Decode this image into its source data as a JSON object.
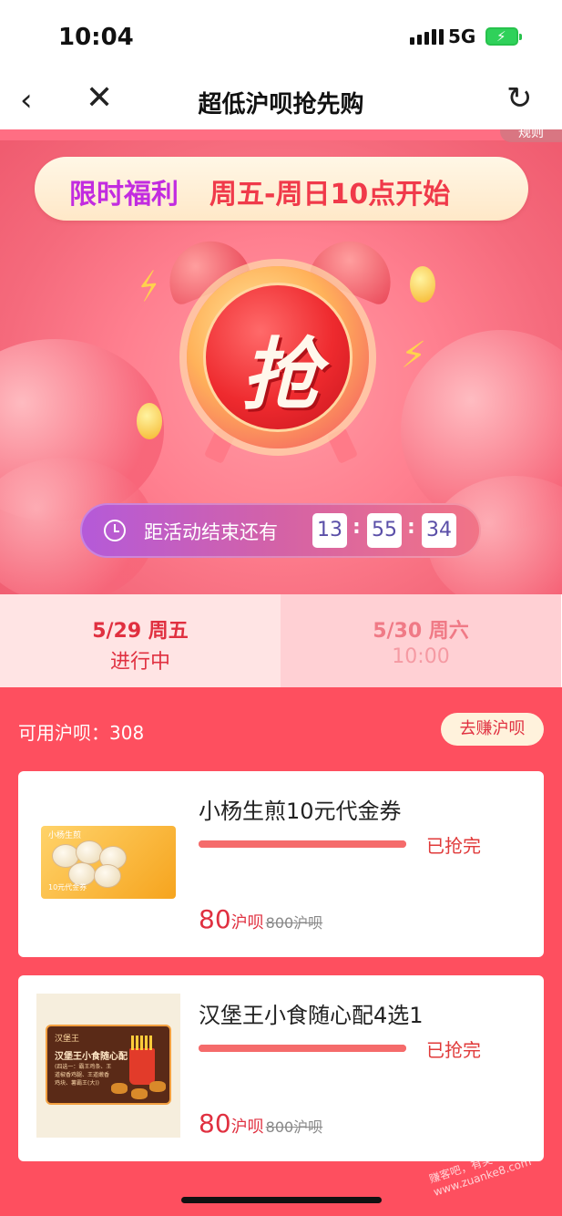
{
  "status_bar": {
    "time": "10:04",
    "network": "5G",
    "battery_color": "#2fd15a"
  },
  "nav": {
    "back_icon": "chevron-left-icon",
    "close_icon": "close-icon",
    "title": "超低沪呗抢先购",
    "refresh_icon": "refresh-icon"
  },
  "hero": {
    "rule_tab": "规则",
    "banner_left": "限时福利",
    "banner_right": "周五-周日10点开始",
    "clock_char": "抢",
    "countdown_label": "距活动结束还有",
    "countdown_hours": "13",
    "countdown_minutes": "55",
    "countdown_seconds": "34",
    "countdown_sep": ":"
  },
  "days": [
    {
      "date": "5/29 周五",
      "status": "进行中",
      "active": true
    },
    {
      "date": "5/30 周六",
      "status": "10:00",
      "active": false
    }
  ],
  "points": {
    "label": "可用沪呗：308",
    "earn_button": "去赚沪呗"
  },
  "products": [
    {
      "title": "小杨生煎10元代金券",
      "thumb_logo": "小杨生煎",
      "thumb_caption": "10元代金券",
      "progress": 1.0,
      "status": "已抢完",
      "price": "80",
      "price_unit": "沪呗",
      "original_price": "800沪呗"
    },
    {
      "title": "汉堡王小食随心配4选1",
      "thumb_brand": "汉堡王",
      "thumb_title": "汉堡王小食随心配",
      "thumb_sub": "(四选一：霸王鸡条、王道椒香鸡腿、王道嫩香鸡块、薯霸王(大))",
      "progress": 1.0,
      "status": "已抢完",
      "price": "80",
      "price_unit": "沪呗",
      "original_price": "800沪呗"
    }
  ],
  "watermark": "赚客吧，有奖一起赚！ www.zuanke8.com",
  "colors": {
    "accent_red": "#e03040",
    "list_bg": "#fe4f5f",
    "banner_purple": "#c22ce0"
  }
}
